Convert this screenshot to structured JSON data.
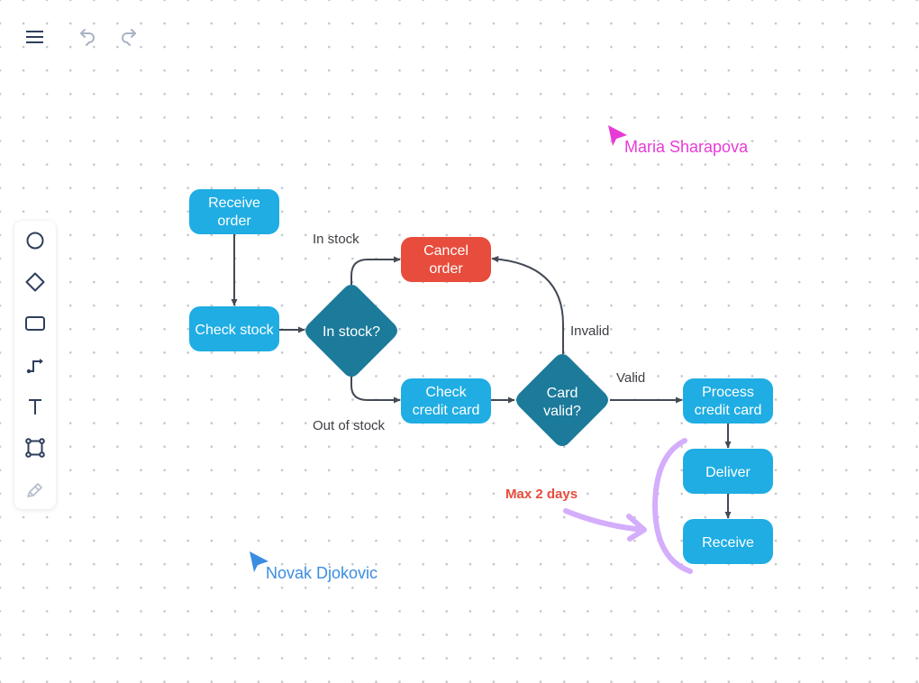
{
  "topbar": {
    "menu_icon": "hamburger-menu-icon",
    "undo_icon": "undo-icon",
    "redo_icon": "redo-icon"
  },
  "toolbar": {
    "tools": [
      {
        "name": "circle",
        "icon": "circle-icon"
      },
      {
        "name": "diamond",
        "icon": "diamond-icon"
      },
      {
        "name": "rectangle",
        "icon": "rectangle-icon"
      },
      {
        "name": "connector",
        "icon": "connector-icon"
      },
      {
        "name": "text",
        "icon": "text-icon"
      },
      {
        "name": "frame",
        "icon": "frame-icon"
      },
      {
        "name": "pen",
        "icon": "pen-icon",
        "disabled": true
      }
    ]
  },
  "colors": {
    "process": "#1fade3",
    "decision": "#1c7a9a",
    "cancel": "#e74c3c",
    "edge": "#434a54",
    "annotation": "#d4adfc",
    "note": "#e74c3c",
    "cursor_maria": "#e83ad7",
    "cursor_novak": "#3b8de0"
  },
  "diagram": {
    "nodes": [
      {
        "id": "receive_order",
        "type": "process",
        "lines": [
          "Receive",
          "order"
        ]
      },
      {
        "id": "check_stock",
        "type": "process",
        "lines": [
          "Check stock"
        ]
      },
      {
        "id": "in_stock",
        "type": "decision",
        "lines": [
          "In stock?"
        ]
      },
      {
        "id": "cancel_order",
        "type": "cancel",
        "lines": [
          "Cancel",
          "order"
        ]
      },
      {
        "id": "check_credit_card",
        "type": "process",
        "lines": [
          "Check",
          "credit card"
        ]
      },
      {
        "id": "card_valid",
        "type": "decision",
        "lines": [
          "Card",
          "valid?"
        ]
      },
      {
        "id": "process_credit_card",
        "type": "process",
        "lines": [
          "Process",
          "credit card"
        ]
      },
      {
        "id": "deliver",
        "type": "process",
        "lines": [
          "Deliver"
        ]
      },
      {
        "id": "receive",
        "type": "process",
        "lines": [
          "Receive"
        ]
      }
    ],
    "edges": [
      {
        "from": "receive_order",
        "to": "check_stock",
        "label": ""
      },
      {
        "from": "check_stock",
        "to": "in_stock",
        "label": ""
      },
      {
        "from": "in_stock",
        "to": "cancel_order",
        "label": "In stock"
      },
      {
        "from": "in_stock",
        "to": "check_credit_card",
        "label": "Out of stock"
      },
      {
        "from": "check_credit_card",
        "to": "card_valid",
        "label": ""
      },
      {
        "from": "card_valid",
        "to": "cancel_order",
        "label": "Invalid"
      },
      {
        "from": "card_valid",
        "to": "process_credit_card",
        "label": "Valid"
      },
      {
        "from": "process_credit_card",
        "to": "deliver",
        "label": ""
      },
      {
        "from": "deliver",
        "to": "receive",
        "label": ""
      }
    ],
    "edge_labels": {
      "in_stock": "In stock",
      "out_of_stock": "Out of stock",
      "invalid": "Invalid",
      "valid": "Valid"
    }
  },
  "annotations": {
    "note": "Max 2 days"
  },
  "collaborators": [
    {
      "name": "Maria Sharapova"
    },
    {
      "name": "Novak Djokovic"
    }
  ]
}
